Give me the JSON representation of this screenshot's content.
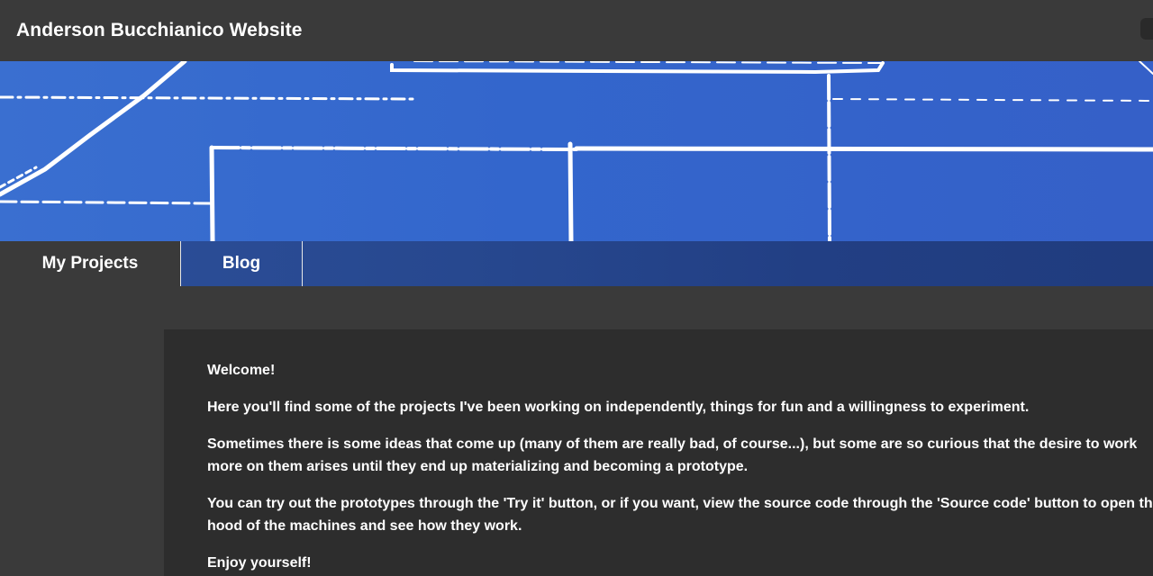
{
  "header": {
    "title": "Anderson Bucchianico Website"
  },
  "banner": {
    "colors": {
      "background": "#3366cc",
      "lines": "#ffffff"
    },
    "icon": "blueprint-pattern"
  },
  "nav": {
    "tabs": [
      {
        "label": "My Projects",
        "active": true
      },
      {
        "label": "Blog",
        "active": false
      }
    ]
  },
  "main": {
    "paragraphs": [
      "Welcome!",
      "Here you'll find some of the projects I've been working on independently, things for fun and a willingness to experiment.",
      "Sometimes there is some ideas that come up (many of them are really bad, of course...), but some are so curious that the desire to work more on them arises until they end up materializing and becoming a prototype.",
      "You can try out the prototypes through the 'Try it' button, or if you want, view the source code through the 'Source code' button to open the hood of the machines and see how they work.",
      "Enjoy yourself!"
    ]
  }
}
